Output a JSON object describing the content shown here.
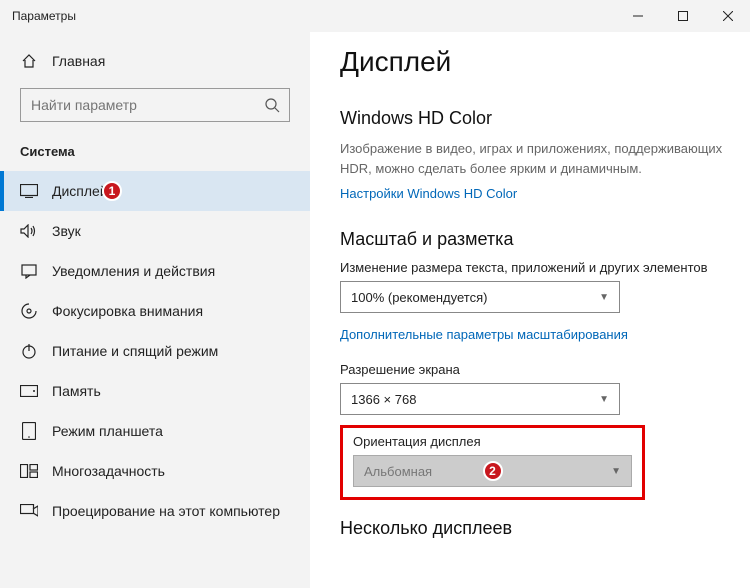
{
  "window": {
    "title": "Параметры"
  },
  "sidebar": {
    "home": "Главная",
    "search_placeholder": "Найти параметр",
    "category": "Система",
    "items": [
      {
        "label": "Дисплей"
      },
      {
        "label": "Звук"
      },
      {
        "label": "Уведомления и действия"
      },
      {
        "label": "Фокусировка внимания"
      },
      {
        "label": "Питание и спящий режим"
      },
      {
        "label": "Память"
      },
      {
        "label": "Режим планшета"
      },
      {
        "label": "Многозадачность"
      },
      {
        "label": "Проецирование на этот компьютер"
      }
    ]
  },
  "main": {
    "title": "Дисплей",
    "hd": {
      "heading": "Windows HD Color",
      "desc": "Изображение в видео, играх и приложениях, поддерживающих HDR, можно сделать более ярким и динамичным.",
      "link": "Настройки Windows HD Color"
    },
    "scale": {
      "heading": "Масштаб и разметка",
      "change_label": "Изменение размера текста, приложений и других элементов",
      "scale_value": "100% (рекомендуется)",
      "adv_link": "Дополнительные параметры масштабирования",
      "res_label": "Разрешение экрана",
      "res_value": "1366 × 768",
      "orient_label": "Ориентация дисплея",
      "orient_value": "Альбомная"
    },
    "multi_heading": "Несколько дисплеев"
  },
  "badges": {
    "b1": "1",
    "b2": "2"
  }
}
